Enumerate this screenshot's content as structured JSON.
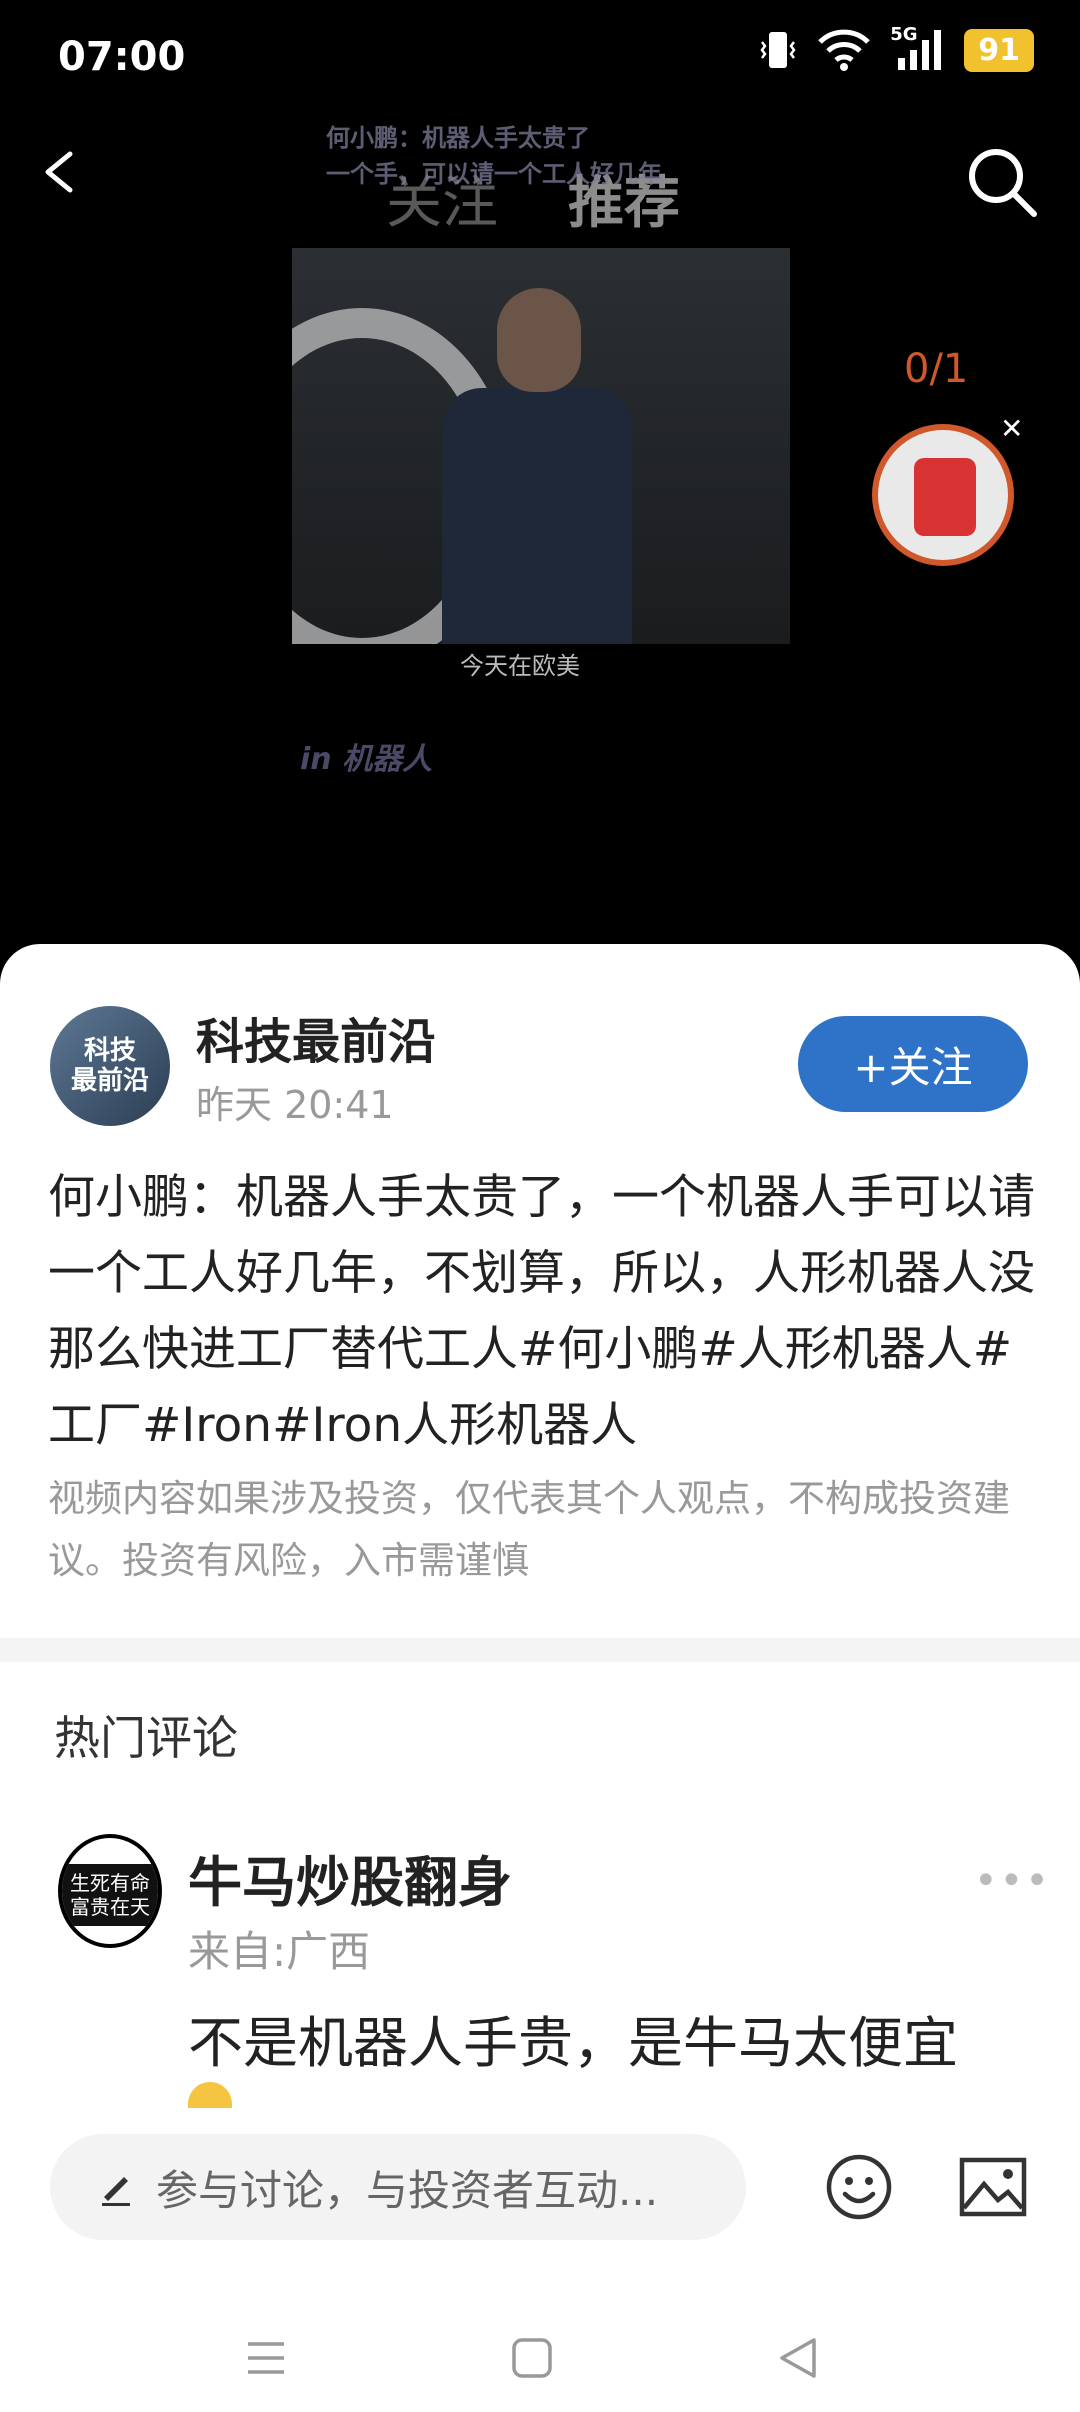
{
  "status_bar": {
    "time": "07:00",
    "signal_label": "5G",
    "battery": "91"
  },
  "top_nav": {
    "tabs": [
      {
        "label": "关注"
      },
      {
        "label": "推荐"
      }
    ]
  },
  "video": {
    "overlay_title": "何小鹏：机器人手太贵了\n一个手，可以请一个工人好几年",
    "subtitle": "今天在欧美",
    "watermark": "in 机器人",
    "counter": "0/1"
  },
  "post": {
    "author": "科技最前沿",
    "avatar_text": "科技\n最前沿",
    "time": "昨天 20:41",
    "follow_label": "+关注",
    "text": "何小鹏：机器人手太贵了，一个机器人手可以请一个工人好几年，不划算，所以，人形机器人没那么快进工厂替代工人#何小鹏#人形机器人#工厂#Iron#Iron人形机器人",
    "disclaimer": "视频内容如果涉及投资，仅代表其个人观点，不构成投资建议。投资有风险，入市需谨慎"
  },
  "comments": {
    "section_title": "热门评论",
    "items": [
      {
        "user": "牛马炒股翻身",
        "avatar_text": "生死有命\n富贵在天",
        "location": "来自:广西",
        "text": "不是机器人手贵，是牛马太便宜"
      }
    ]
  },
  "composer": {
    "placeholder": "参与讨论，与投资者互动..."
  }
}
